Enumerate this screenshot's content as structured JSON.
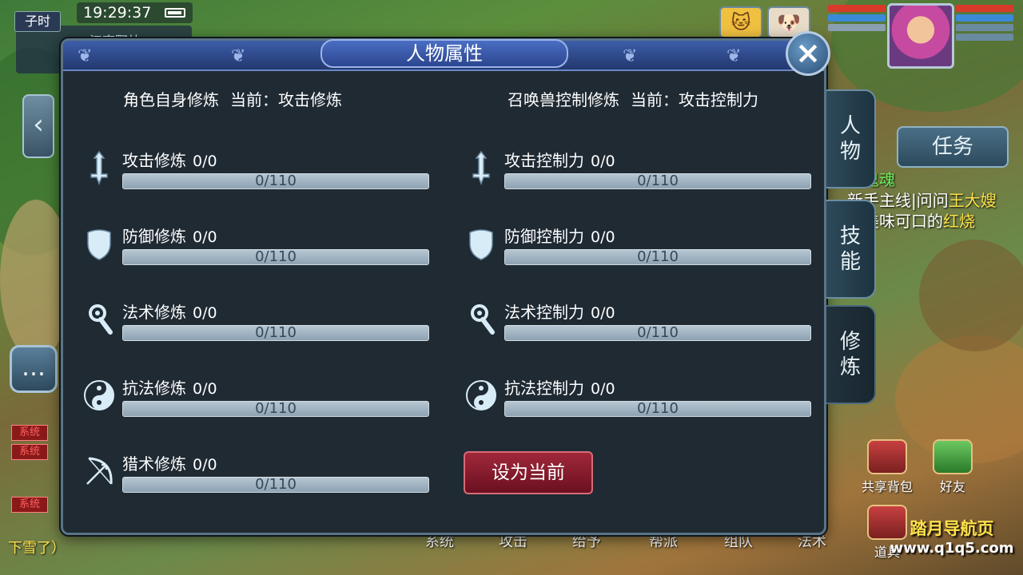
{
  "status": {
    "time": "19:29:37",
    "time_period": "子时",
    "location": "江南野外"
  },
  "dialog": {
    "title": "人物属性",
    "close_icon": "close-icon",
    "left_section": {
      "label": "角色自身修炼",
      "current": "当前：攻击修炼"
    },
    "right_section": {
      "label": "召唤兽控制修炼",
      "current": "当前：攻击控制力"
    },
    "left_stats": [
      {
        "name": "攻击修炼",
        "value": "0/0",
        "bar_text": "0/110",
        "progress": 0,
        "icon": "sword-icon"
      },
      {
        "name": "防御修炼",
        "value": "0/0",
        "bar_text": "0/110",
        "progress": 0,
        "icon": "shield-icon"
      },
      {
        "name": "法术修炼",
        "value": "0/0",
        "bar_text": "0/110",
        "progress": 0,
        "icon": "staff-icon"
      },
      {
        "name": "抗法修炼",
        "value": "0/0",
        "bar_text": "0/110",
        "progress": 0,
        "icon": "yin-yang-icon"
      },
      {
        "name": "猎术修炼",
        "value": "0/0",
        "bar_text": "0/110",
        "progress": 0,
        "icon": "bow-icon"
      }
    ],
    "right_stats": [
      {
        "name": "攻击控制力",
        "value": "0/0",
        "bar_text": "0/110",
        "progress": 0,
        "icon": "sword-icon"
      },
      {
        "name": "防御控制力",
        "value": "0/0",
        "bar_text": "0/110",
        "progress": 0,
        "icon": "shield-icon"
      },
      {
        "name": "法术控制力",
        "value": "0/0",
        "bar_text": "0/110",
        "progress": 0,
        "icon": "staff-icon"
      },
      {
        "name": "抗法控制力",
        "value": "0/0",
        "bar_text": "0/110",
        "progress": 0,
        "icon": "yin-yang-icon"
      }
    ],
    "set_current_button": "设为当前"
  },
  "side_tabs": [
    {
      "label_top": "人",
      "label_bottom": "物"
    },
    {
      "label_top": "技",
      "label_bottom": "能"
    },
    {
      "label_top": "修",
      "label_bottom": "炼",
      "active": true
    }
  ],
  "quest": {
    "task_button": "任务",
    "line1": "的鬼魂",
    "line2_prefix": "新手主线|问问",
    "line2_highlight": "王大嫂",
    "line3_prefix": "有美味可口的",
    "line3_highlight": "红烧"
  },
  "bottom_icons": {
    "shared_bag": "共享背包",
    "friends": "好友",
    "items": "道具"
  },
  "bottom_menu": [
    "系统",
    "攻击",
    "给予",
    "帮派",
    "组队",
    "法术"
  ],
  "system_tag": "系统",
  "chat_snippet": "下雪了）",
  "watermark": {
    "line1": "踏月导航页",
    "line2": "www.q1q5.com"
  },
  "colors": {
    "accent_blue": "#3d5eaa",
    "quest_green": "#6cf05a",
    "quest_yellow": "#ffe14a",
    "button_red": "#a0283a"
  }
}
